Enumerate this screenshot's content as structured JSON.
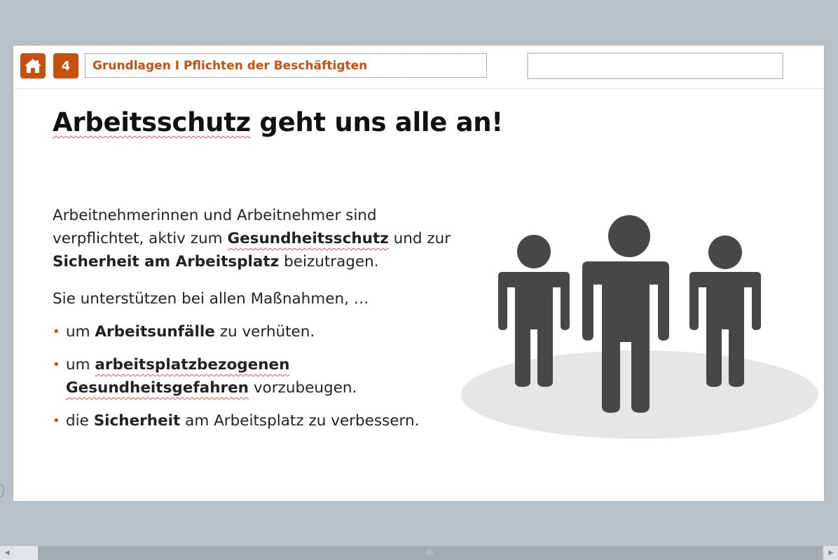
{
  "header": {
    "home_icon": "home-icon",
    "chapter_number": "4",
    "chapter_title": "Grundlagen I Pflichten der Beschäftigten",
    "accent_color": "#c8500f"
  },
  "slide": {
    "title": "Arbeitsschutz geht uns alle an!",
    "intro": {
      "part1": "Arbeitnehmerinnen und Arbeitnehmer sind verpflichtet, aktiv zum ",
      "bold1": "Gesundheitsschutz",
      "part2": " und zur ",
      "bold2": "Sicherheit am Arbeitsplatz",
      "part3": " beizutragen."
    },
    "lead": "Sie unterstützen bei allen Maßnahmen, …",
    "bullets": [
      {
        "pre": "um ",
        "bold": "Arbeitsunfälle",
        "post": " zu verhüten."
      },
      {
        "pre": "um ",
        "bold": "arbeitsplatzbezogenen Gesundheitsgefahren",
        "post": " vorzubeugen."
      },
      {
        "pre": "die ",
        "bold": "Sicherheit",
        "post": " am Arbeitsplatz zu verbessern."
      }
    ],
    "bullet_char": "•",
    "illustration_icon": "three-people-icon"
  },
  "scrollbar": {
    "left_arrow": "◀",
    "right_arrow": "▶",
    "grip": "III"
  }
}
